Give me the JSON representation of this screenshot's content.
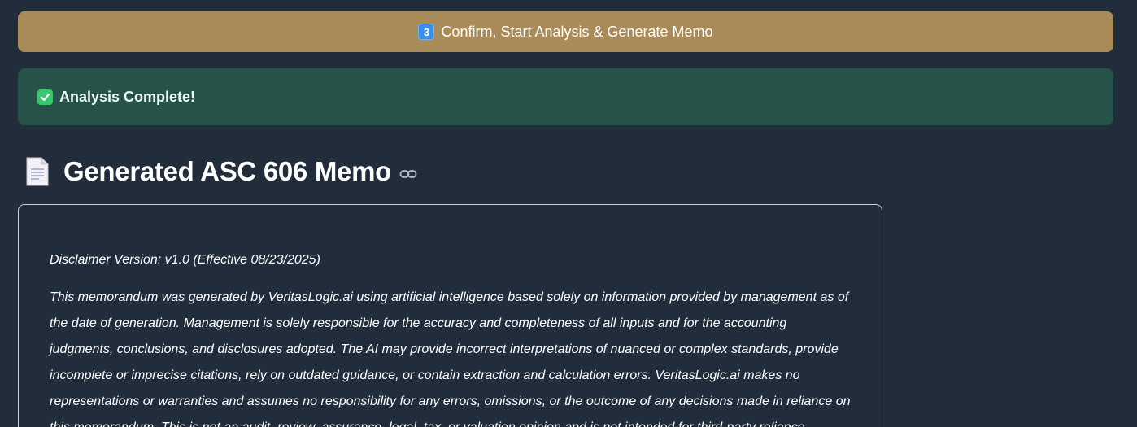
{
  "action_button": {
    "keycap": "3",
    "label": "Confirm, Start Analysis & Generate Memo"
  },
  "status": {
    "text": "Analysis Complete!",
    "icon": "check-mark-button-icon"
  },
  "memo_section": {
    "icon": "page-facing-up-icon",
    "title": "Generated ASC 606 Memo",
    "anchor_icon": "link-icon"
  },
  "memo": {
    "version": "Disclaimer Version: v1.0 (Effective 08/23/2025)",
    "body": "This memorandum was generated by VeritasLogic.ai using artificial intelligence based solely on information provided by management as of the date of generation. Management is solely responsible for the accuracy and completeness of all inputs and for the accounting judgments, conclusions, and disclosures adopted. The AI may provide incorrect interpretations of nuanced or complex standards, provide incomplete or imprecise citations, rely on outdated guidance, or contain extraction and calculation errors. VeritasLogic.ai makes no representations or warranties and assumes no responsibility for any errors, omissions, or the outcome of any decisions made in reliance on this memorandum. This is not an audit, review, assurance, legal, tax, or valuation opinion and is not intended for third-party reliance."
  },
  "colors": {
    "background": "#222d3c",
    "button": "#a88b58",
    "success_bg": "#26524a",
    "success_check": "#38c76d"
  }
}
